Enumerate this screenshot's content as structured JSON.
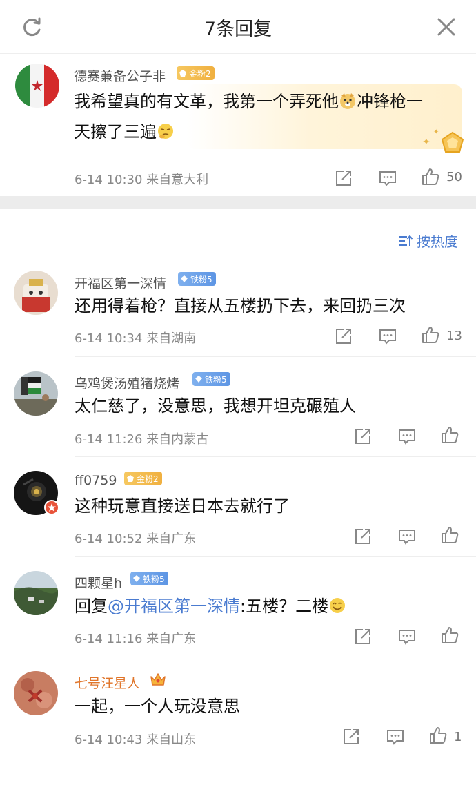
{
  "header": {
    "title": "7条回复"
  },
  "root": {
    "username": "德赛兼备公子非",
    "badge": "金粉2",
    "text_line1": "我希望真的有文革，我第一个弄死他",
    "text_line1b": "冲锋枪一",
    "text_line2": "天擦了三遍",
    "meta": "6-14 10:30  来自意大利",
    "likes": "50"
  },
  "sort": {
    "label": "按热度"
  },
  "replies": [
    {
      "username": "开福区第一深情",
      "badge": "铁粉5",
      "text": "还用得着枪？直接从五楼扔下去，来回扔三次",
      "meta": "6-14 10:34  来自湖南",
      "likes": "13"
    },
    {
      "username": "乌鸡煲汤殖猪烧烤",
      "badge": "铁粉5",
      "text": "太仁慈了，没意思，我想开坦克碾殖人",
      "meta": "6-14 11:26  来自内蒙古",
      "likes": ""
    },
    {
      "username": "ff0759",
      "badge": "金粉2",
      "text": "这种玩意直接送日本去就行了",
      "meta": "6-14 10:52  来自广东",
      "likes": ""
    },
    {
      "username": "四颗星h",
      "badge": "铁粉5",
      "text_prefix": "回复",
      "mention": "@开福区第一深情",
      "text_suffix": ":五楼？二楼",
      "meta": "6-14 11:16  来自广东",
      "likes": ""
    },
    {
      "username": "七号汪星人",
      "badge": "",
      "text": "一起，一个人玩没意思",
      "meta": "6-14 10:43  来自山东",
      "likes": "1"
    }
  ],
  "icons": {
    "refresh": "refresh-icon",
    "close": "close-icon",
    "share": "share-icon",
    "comment": "comment-icon",
    "like": "thumbs-up-icon",
    "sort": "sort-icon",
    "crown": "crown-icon"
  },
  "colors": {
    "accent": "#4a7bd0",
    "vip_name": "#e0752a",
    "gold_badge": "#f0b040",
    "iron_badge": "#5d95e4"
  }
}
